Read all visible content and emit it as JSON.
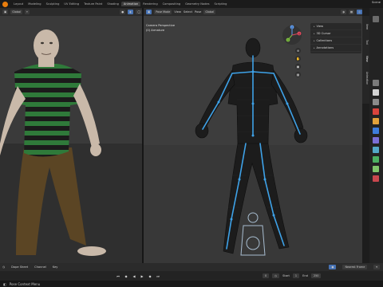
{
  "menu": {
    "tabs": [
      "Layout",
      "Modeling",
      "Sculpting",
      "UV Editing",
      "Texture Paint",
      "Shading",
      "Animation",
      "Rendering",
      "Compositing",
      "Geometry Nodes",
      "Scripting"
    ],
    "active_tab": "Animation",
    "scene_label": "Scene"
  },
  "left_header": {
    "global_label": "Global",
    "pose_options": "Pose Options"
  },
  "right_header": {
    "mode_label": "Pose Mode",
    "view": "View",
    "select": "Select",
    "pose": "Pose",
    "global_label": "Global",
    "pose_options": "Pose Options"
  },
  "viewport": {
    "camera_label": "Camera Perspective",
    "object_label": "(0) Armature"
  },
  "overlay_panel": {
    "items": [
      "View",
      "3D Cursor",
      "Collections",
      "Annotations"
    ]
  },
  "sidebar_tabs": [
    "Item",
    "Tool",
    "View",
    "Animation"
  ],
  "gizmo": {
    "y_label": "Y",
    "z_label": "Z",
    "x_label": "X"
  },
  "timeline": {
    "items": [
      "Playback",
      "Keying",
      "View",
      "Marker"
    ],
    "left_items": [
      "Dope Sheet",
      "Channel",
      "Key"
    ],
    "keying": "Nearest Frame",
    "current_frame": "0",
    "start_label": "Start",
    "start": "1",
    "end_label": "End",
    "end": "250"
  },
  "status": {
    "text": "Pose Context Menu"
  },
  "colors": {
    "accent": "#4772b3",
    "shirt_green": "#2f7a3a",
    "pants_brown": "#5b4524",
    "skin": "#c9b9a9",
    "bone_blue": "#3ea2e8"
  }
}
